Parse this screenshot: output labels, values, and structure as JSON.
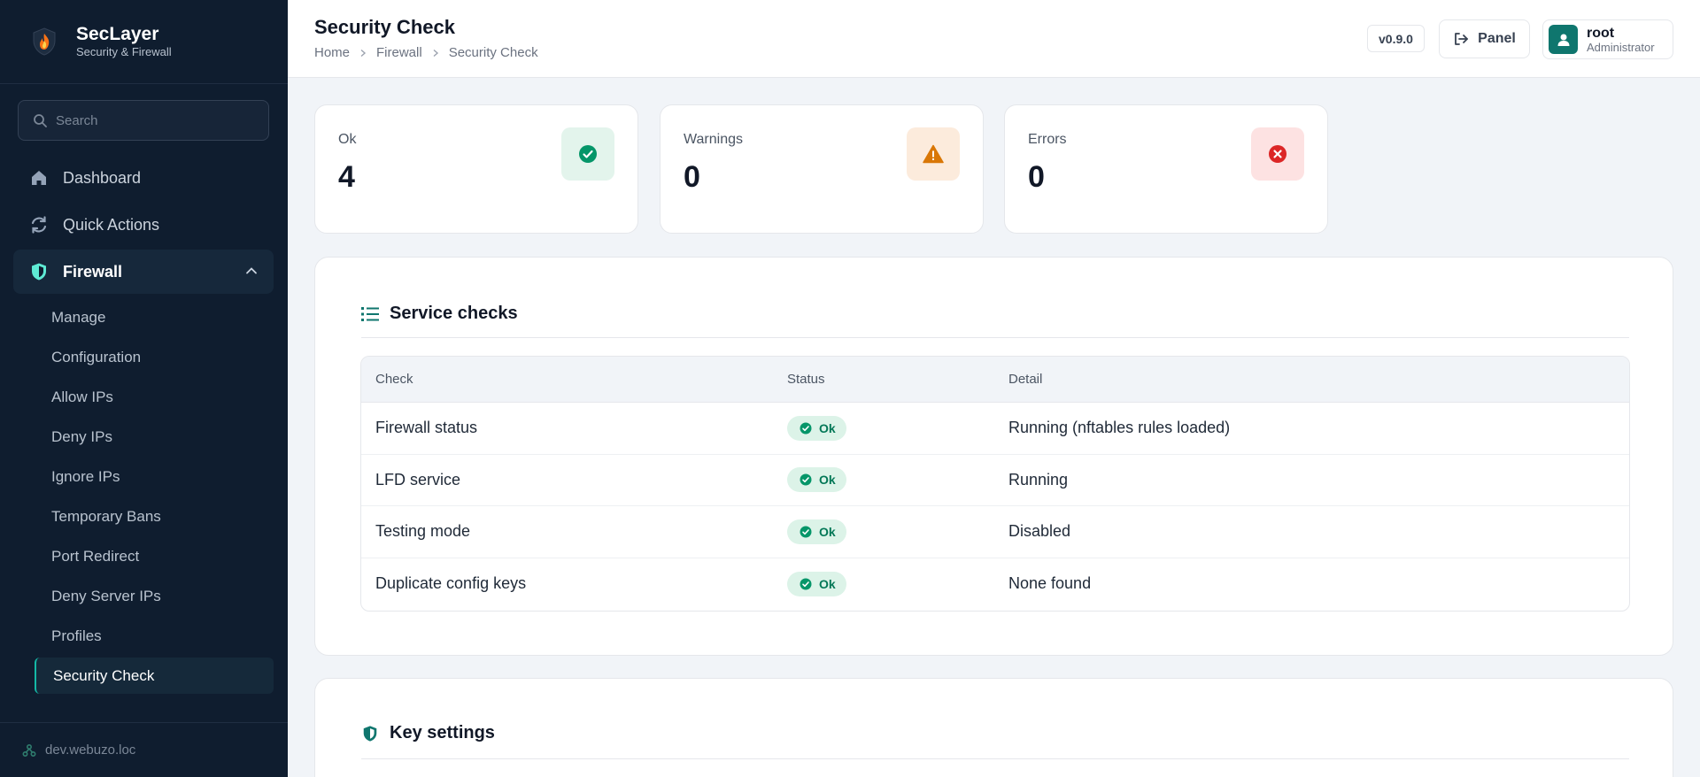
{
  "brand": {
    "name": "SecLayer",
    "subtitle": "Security & Firewall"
  },
  "search": {
    "placeholder": "Search"
  },
  "nav": {
    "dashboard": "Dashboard",
    "quick_actions": "Quick Actions",
    "firewall": "Firewall",
    "sub_items": [
      "Manage",
      "Configuration",
      "Allow IPs",
      "Deny IPs",
      "Ignore IPs",
      "Temporary Bans",
      "Port Redirect",
      "Deny Server IPs",
      "Profiles",
      "Security Check"
    ],
    "active_sub": "Security Check"
  },
  "footer": {
    "host": "dev.webuzo.loc"
  },
  "header": {
    "title": "Security Check",
    "breadcrumb": [
      "Home",
      "Firewall",
      "Security Check"
    ],
    "version": "v0.9.0",
    "panel_label": "Panel",
    "user_name": "root",
    "user_role": "Administrator"
  },
  "stats": [
    {
      "label": "Ok",
      "value": "4",
      "icon": "check-circle-icon",
      "color": "#059669",
      "bg": "#e3f4ec"
    },
    {
      "label": "Warnings",
      "value": "0",
      "icon": "warning-triangle-icon",
      "color": "#d97706",
      "bg": "#fcebdc"
    },
    {
      "label": "Errors",
      "value": "0",
      "icon": "x-circle-icon",
      "color": "#dc2626",
      "bg": "#fde2e2"
    }
  ],
  "service_checks": {
    "title": "Service checks",
    "columns": [
      "Check",
      "Status",
      "Detail"
    ],
    "rows": [
      {
        "check": "Firewall status",
        "status": "Ok",
        "detail": "Running (nftables rules loaded)"
      },
      {
        "check": "LFD service",
        "status": "Ok",
        "detail": "Running"
      },
      {
        "check": "Testing mode",
        "status": "Ok",
        "detail": "Disabled"
      },
      {
        "check": "Duplicate config keys",
        "status": "Ok",
        "detail": "None found"
      }
    ]
  },
  "key_settings": {
    "title": "Key settings"
  },
  "colors": {
    "sidebar_bg": "#0f1d2f",
    "accent": "#14b8a6",
    "ok": "#059669"
  }
}
